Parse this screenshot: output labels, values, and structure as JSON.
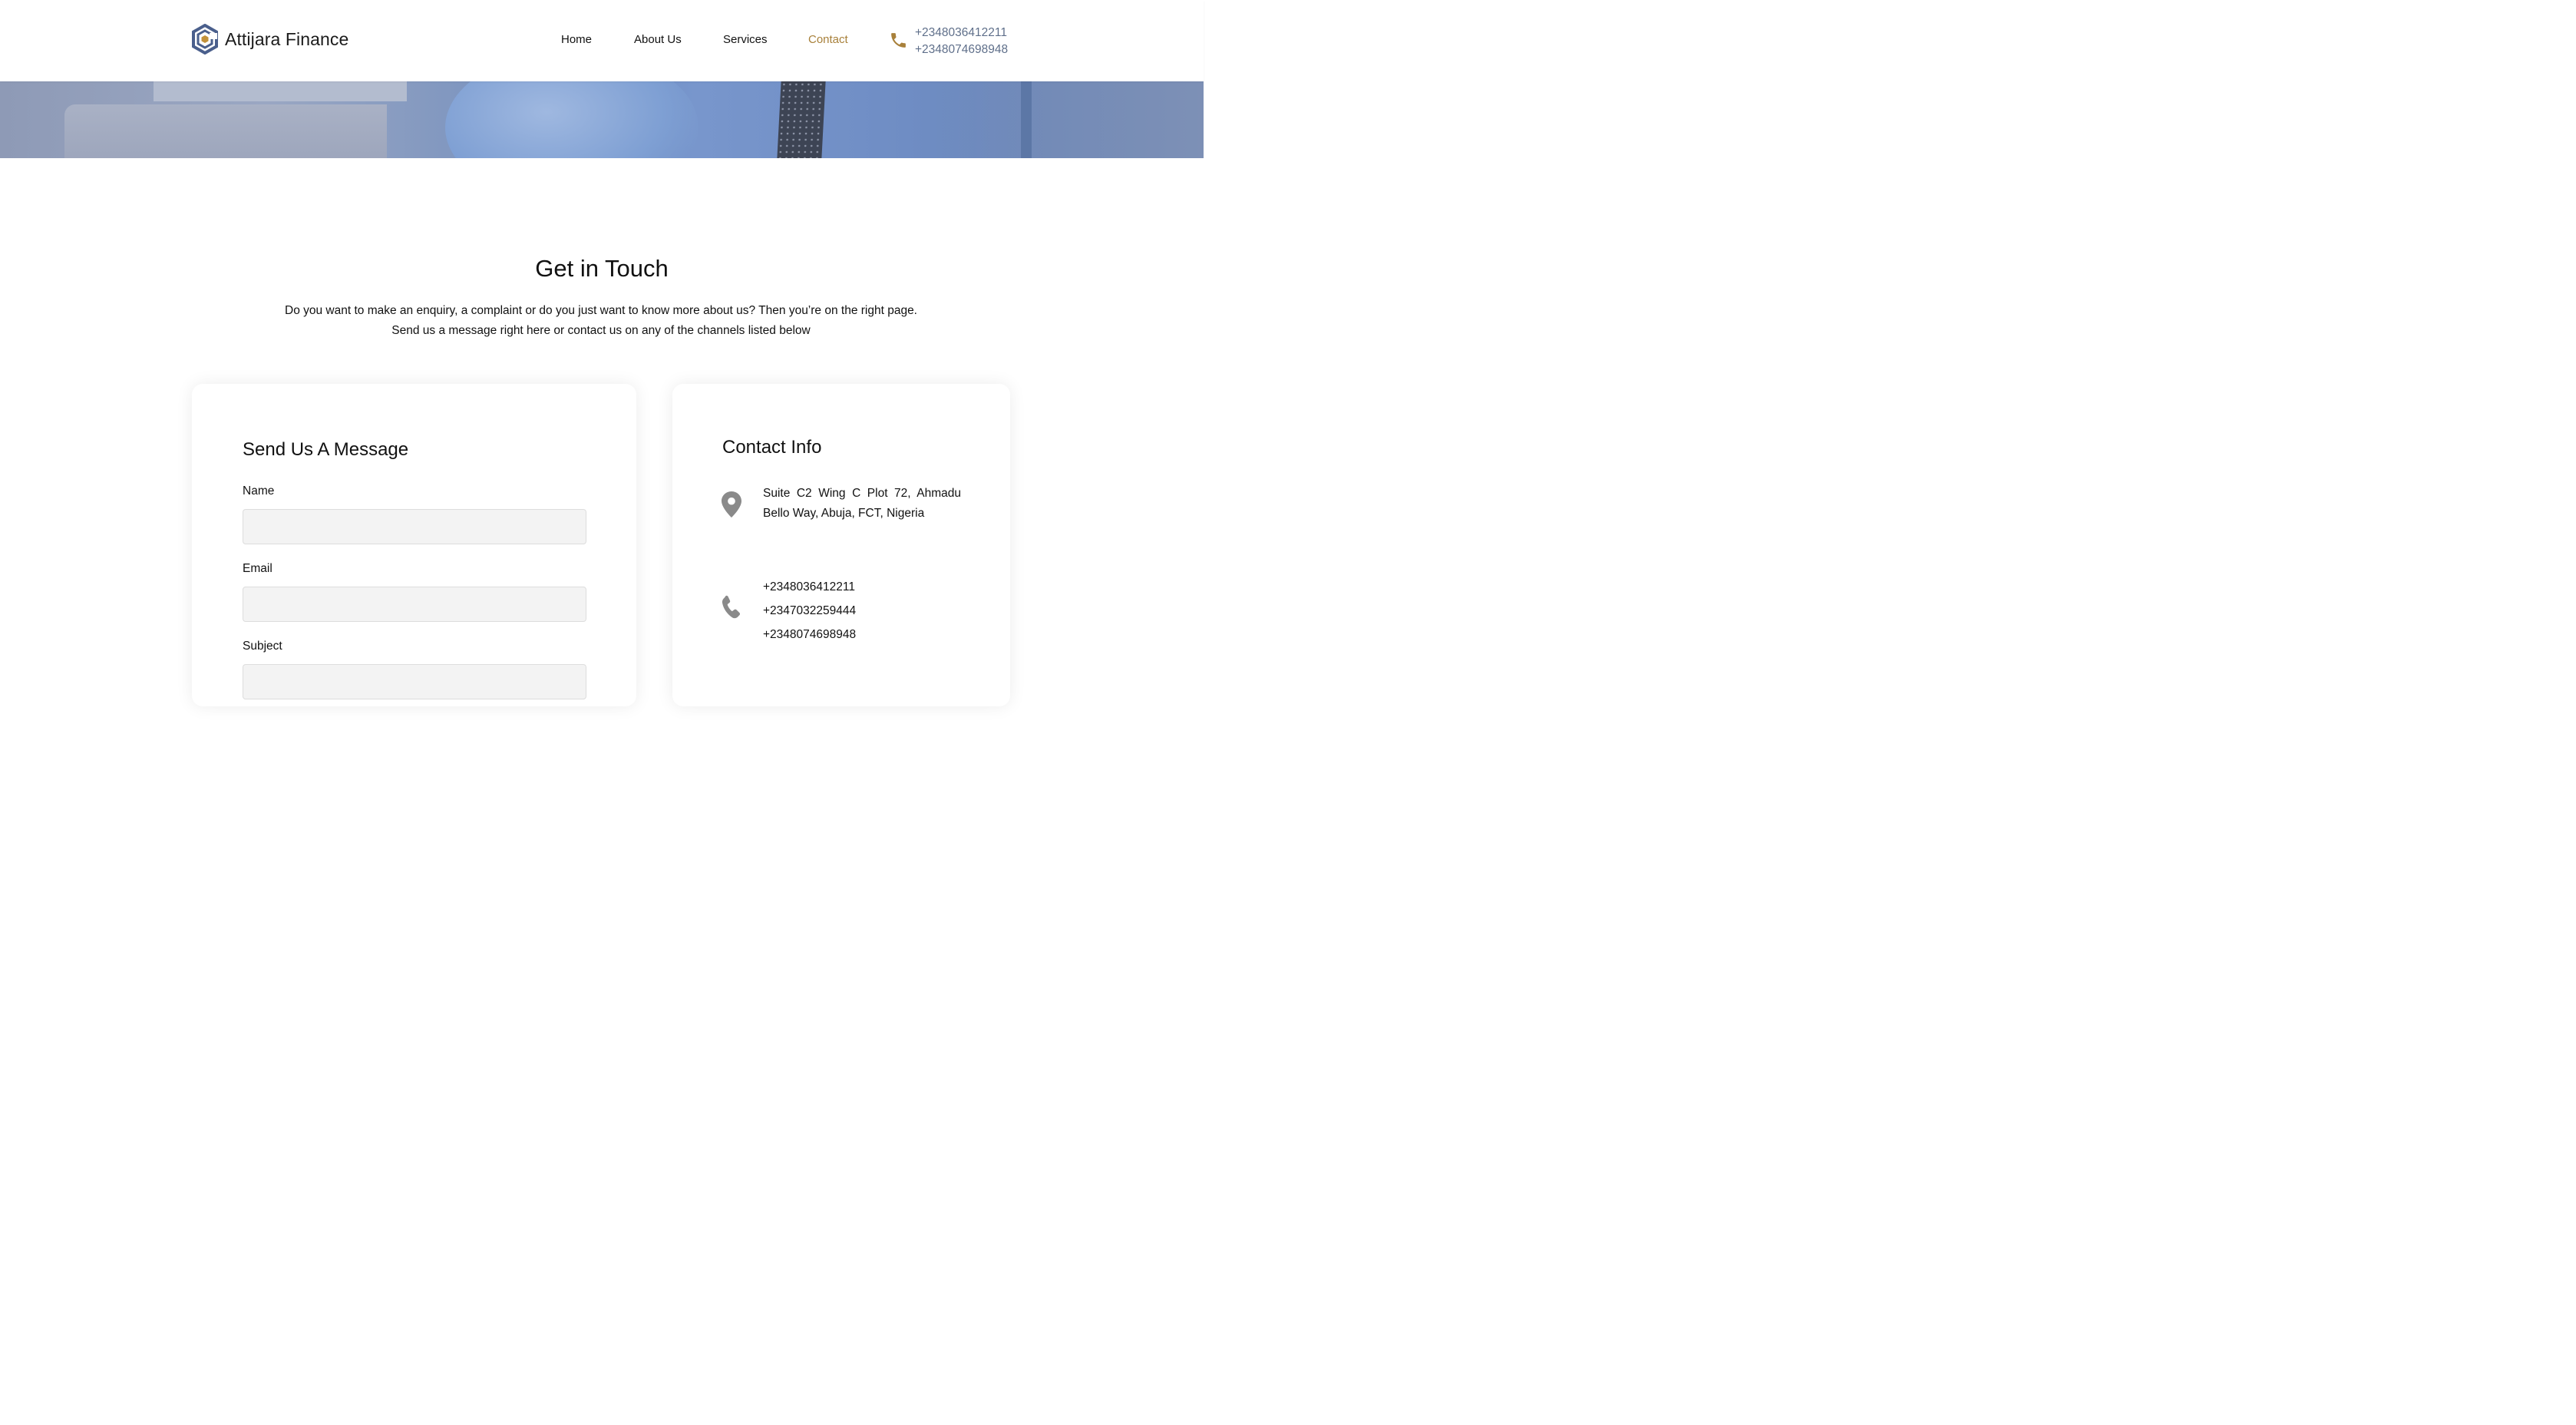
{
  "brand": {
    "name": "Attijara Finance"
  },
  "nav": {
    "items": [
      {
        "label": "Home",
        "active": false
      },
      {
        "label": "About Us",
        "active": false
      },
      {
        "label": "Services",
        "active": false
      },
      {
        "label": "Contact",
        "active": true
      }
    ]
  },
  "header_contact": {
    "icon": "phone-icon",
    "phones": [
      "+2348036412211",
      "+2348074698948"
    ]
  },
  "intro": {
    "title": "Get in Touch",
    "text": "Do you want to make an enquiry, a complaint or do you just want to know more about us? Then you’re on the right page. Send us a message right here or contact us on any of the channels listed below"
  },
  "message_form": {
    "title": "Send Us A Message",
    "fields": [
      {
        "label": "Name",
        "value": "",
        "placeholder": ""
      },
      {
        "label": "Email",
        "value": "",
        "placeholder": ""
      },
      {
        "label": "Subject",
        "value": "",
        "placeholder": ""
      }
    ]
  },
  "contact_info": {
    "title": "Contact Info",
    "address": "Suite C2 Wing C Plot 72, Ahmadu Bello Way, Abuja, FCT, Nigeria",
    "address_icon": "map-pin-icon",
    "phone_icon": "phone-icon",
    "phones": [
      "+2348036412211",
      "+2347032259444",
      "+2348074698948"
    ]
  },
  "colors": {
    "accent_gold": "#a8803a",
    "logo_blue": "#4a5f8c",
    "header_phone_text": "#5f6f8a",
    "icon_gray": "#8a8a8a",
    "input_bg": "#f3f3f3"
  }
}
